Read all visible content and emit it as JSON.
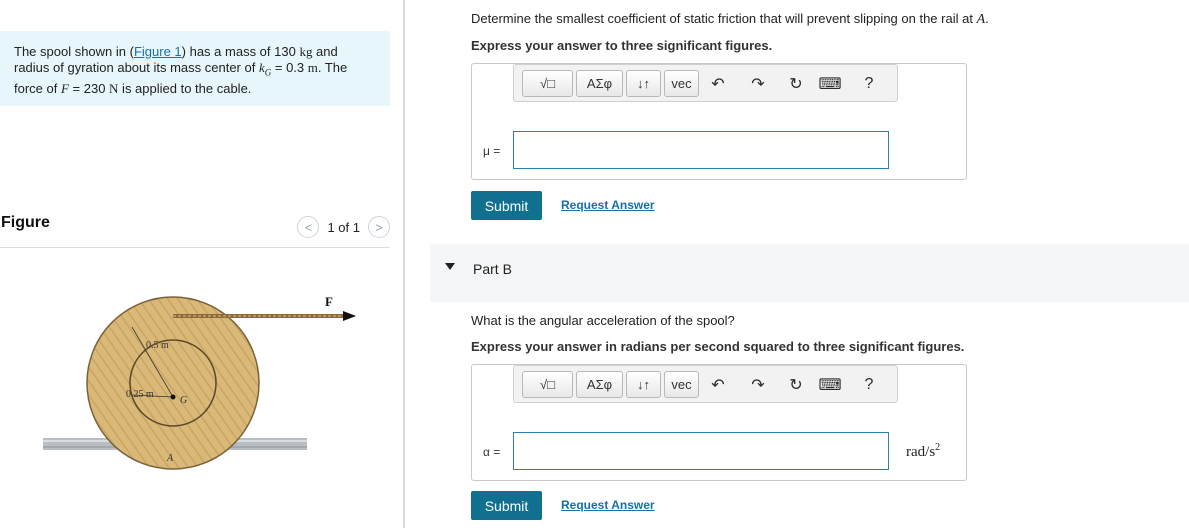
{
  "problem": {
    "t1": "The spool shown in (",
    "link": "Figure 1",
    "t2": ") has a mass of 130 ",
    "kg": "kg",
    "t3": " and radius of gyration about its mass center of ",
    "kG": "k",
    "kGsub": "G",
    "t4": " = 0.3 ",
    "m": "m",
    "t5": ". The force of ",
    "F": "F",
    "t6": " = 230 ",
    "N": "N",
    "t7": " is applied to the cable."
  },
  "figure": {
    "title": "Figure",
    "pager": "1 of 1",
    "prev": "<",
    "next": ">",
    "labels": {
      "F": "F",
      "r_outer": "0.5 m",
      "r_inner": "0.25 m",
      "G": "G",
      "A": "A"
    }
  },
  "partA": {
    "question": "Determine the smallest coefficient of static friction that will prevent slipping on the rail at ",
    "point": "A",
    "period": ".",
    "instruction": "Express your answer to three significant figures.",
    "var_label": "μ =",
    "submit": "Submit",
    "request": "Request Answer"
  },
  "partB": {
    "header": "Part B",
    "question": "What is the angular acceleration of the spool?",
    "instruction": "Express your answer in radians per second squared to three significant figures.",
    "var_label": "α =",
    "unit": "rad/s",
    "unit_exp": "2",
    "submit": "Submit",
    "request": "Request Answer"
  },
  "toolbar": {
    "templates": "√□",
    "greek": "ΑΣφ",
    "arrows": "↓↑",
    "vec": "vec",
    "undo": "↶",
    "redo": "↷",
    "reset": "↻",
    "keyboard": "⌨",
    "help": "?"
  },
  "colors": {
    "accent": "#11708f",
    "link": "#1a6fa8",
    "problem_bg": "#e6f6fa"
  }
}
